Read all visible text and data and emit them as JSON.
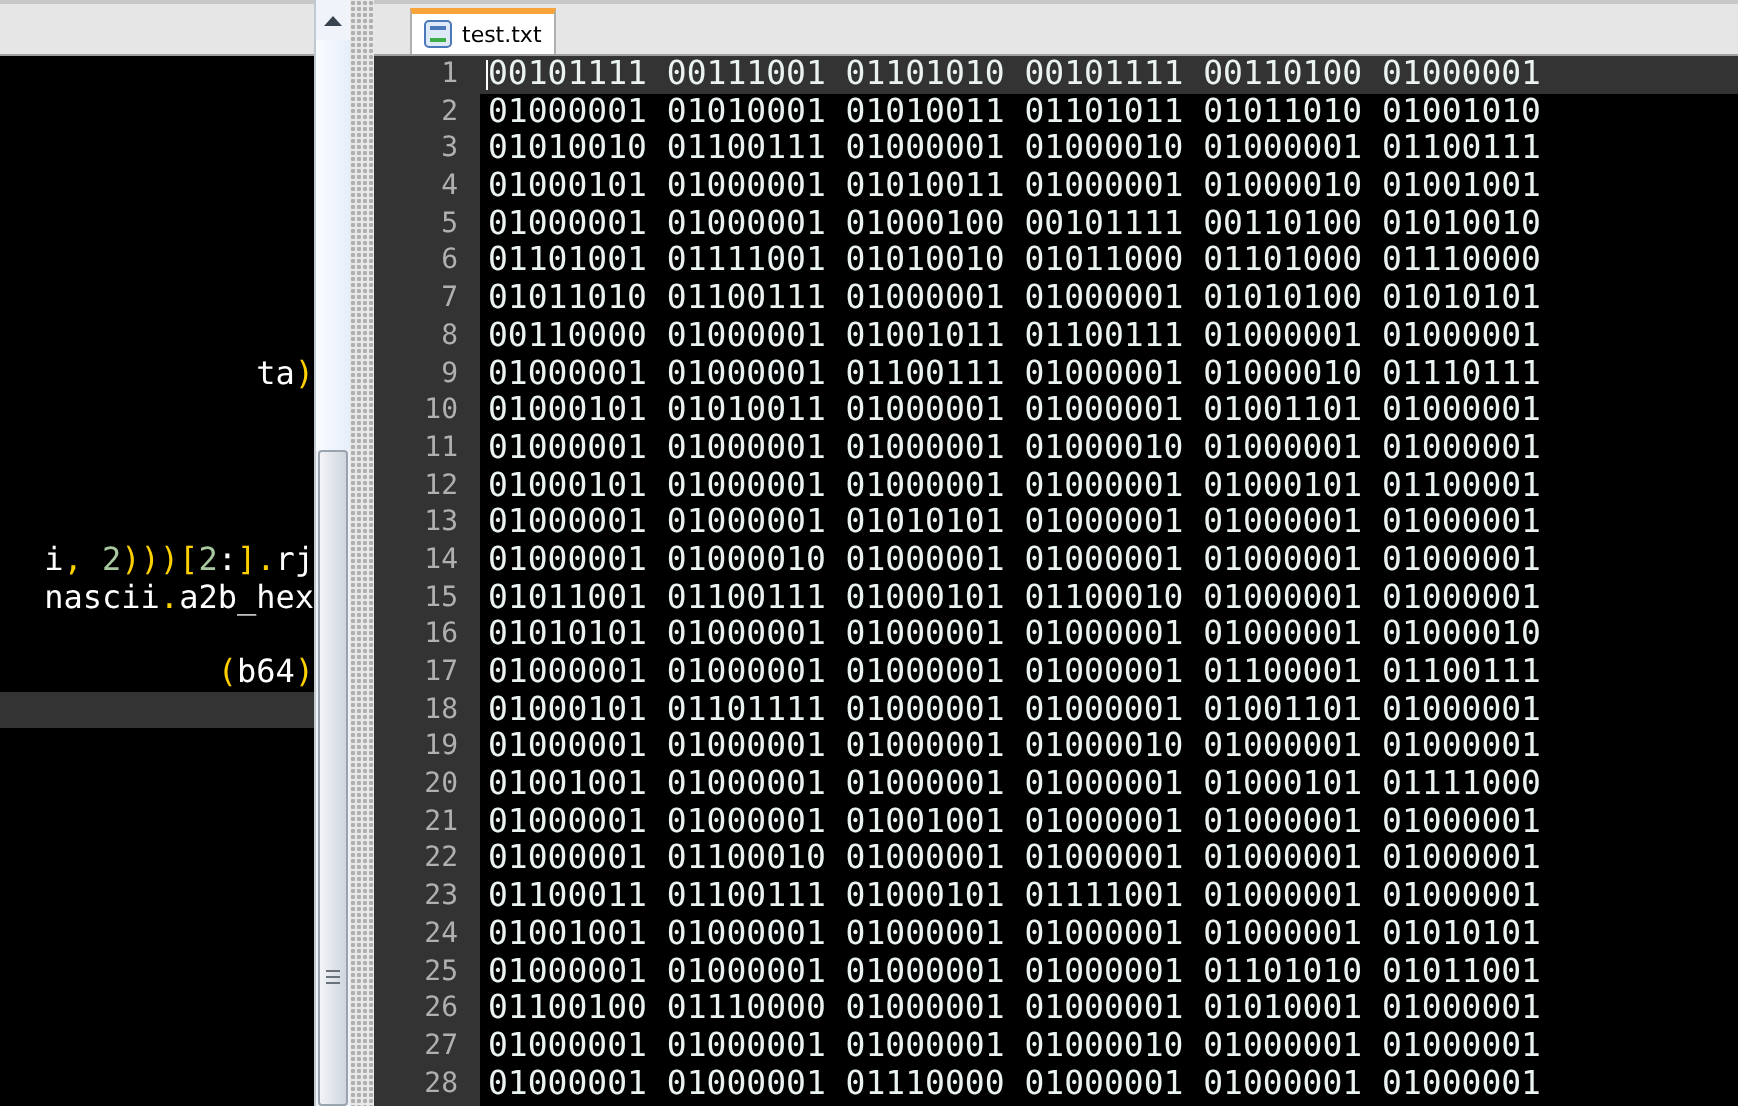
{
  "left_pane": {
    "lines": [
      {
        "current": false
      },
      {
        "current": false
      },
      {
        "current": false
      },
      {
        "current": false
      },
      {
        "current": false
      },
      {
        "current": false
      },
      {
        "current": false
      },
      {
        "current": false
      },
      {
        "current": false,
        "segments": [
          {
            "text": "ta",
            "kind": "plain"
          },
          {
            "text": ")",
            "kind": "punct"
          }
        ]
      },
      {
        "current": false
      },
      {
        "current": false
      },
      {
        "current": false
      },
      {
        "current": false
      },
      {
        "current": false,
        "segments": [
          {
            "text": "i",
            "kind": "plain"
          },
          {
            "text": ", ",
            "kind": "punct"
          },
          {
            "text": "2",
            "kind": "number"
          },
          {
            "text": ")))[",
            "kind": "punct"
          },
          {
            "text": "2",
            "kind": "number"
          },
          {
            "text": ":",
            "kind": "plain"
          },
          {
            "text": "].",
            "kind": "punct"
          },
          {
            "text": "rj",
            "kind": "plain"
          }
        ]
      },
      {
        "current": false,
        "segments": [
          {
            "text": "nascii",
            "kind": "plain"
          },
          {
            "text": ".",
            "kind": "punct"
          },
          {
            "text": "a2b_hex",
            "kind": "plain"
          }
        ]
      },
      {
        "current": false
      },
      {
        "current": false,
        "segments": [
          {
            "text": "(",
            "kind": "punct"
          },
          {
            "text": "b64",
            "kind": "plain"
          },
          {
            "text": ")",
            "kind": "punct"
          }
        ]
      },
      {
        "current": true
      }
    ]
  },
  "tabs": [
    {
      "label": "test.txt",
      "selected": true
    }
  ],
  "editor": {
    "lines": [
      {
        "number": "1",
        "text": "00101111 00111001 01101010 00101111 00110100 01000001",
        "current": true
      },
      {
        "number": "2",
        "text": "01000001 01010001 01010011 01101011 01011010 01001010",
        "current": false
      },
      {
        "number": "3",
        "text": "01010010 01100111 01000001 01000010 01000001 01100111",
        "current": false
      },
      {
        "number": "4",
        "text": "01000101 01000001 01010011 01000001 01000010 01001001",
        "current": false
      },
      {
        "number": "5",
        "text": "01000001 01000001 01000100 00101111 00110100 01010010",
        "current": false
      },
      {
        "number": "6",
        "text": "01101001 01111001 01010010 01011000 01101000 01110000",
        "current": false
      },
      {
        "number": "7",
        "text": "01011010 01100111 01000001 01000001 01010100 01010101",
        "current": false
      },
      {
        "number": "8",
        "text": "00110000 01000001 01001011 01100111 01000001 01000001",
        "current": false
      },
      {
        "number": "9",
        "text": "01000001 01000001 01100111 01000001 01000010 01110111",
        "current": false
      },
      {
        "number": "10",
        "text": "01000101 01010011 01000001 01000001 01001101 01000001",
        "current": false
      },
      {
        "number": "11",
        "text": "01000001 01000001 01000001 01000010 01000001 01000001",
        "current": false
      },
      {
        "number": "12",
        "text": "01000101 01000001 01000001 01000001 01000101 01100001",
        "current": false
      },
      {
        "number": "13",
        "text": "01000001 01000001 01010101 01000001 01000001 01000001",
        "current": false
      },
      {
        "number": "14",
        "text": "01000001 01000010 01000001 01000001 01000001 01000001",
        "current": false
      },
      {
        "number": "15",
        "text": "01011001 01100111 01000101 01100010 01000001 01000001",
        "current": false
      },
      {
        "number": "16",
        "text": "01010101 01000001 01000001 01000001 01000001 01000010",
        "current": false
      },
      {
        "number": "17",
        "text": "01000001 01000001 01000001 01000001 01100001 01100111",
        "current": false
      },
      {
        "number": "18",
        "text": "01000101 01101111 01000001 01000001 01001101 01000001",
        "current": false
      },
      {
        "number": "19",
        "text": "01000001 01000001 01000001 01000010 01000001 01000001",
        "current": false
      },
      {
        "number": "20",
        "text": "01001001 01000001 01000001 01000001 01000101 01111000",
        "current": false
      },
      {
        "number": "21",
        "text": "01000001 01000001 01001001 01000001 01000001 01000001",
        "current": false
      },
      {
        "number": "22",
        "text": "01000001 01100010 01000001 01000001 01000001 01000001",
        "current": false
      },
      {
        "number": "23",
        "text": "01100011 01100111 01000101 01111001 01000001 01000001",
        "current": false
      },
      {
        "number": "24",
        "text": "01001001 01000001 01000001 01000001 01000001 01010101",
        "current": false
      },
      {
        "number": "25",
        "text": "01000001 01000001 01000001 01000001 01101010 01011001",
        "current": false
      },
      {
        "number": "26",
        "text": "01100100 01110000 01000001 01000001 01010001 01000001",
        "current": false
      },
      {
        "number": "27",
        "text": "01000001 01000001 01000001 01000010 01000001 01000001",
        "current": false
      },
      {
        "number": "28",
        "text": "01000001 01000001 01110000 01000001 01000001 01000001",
        "current": false
      }
    ]
  }
}
